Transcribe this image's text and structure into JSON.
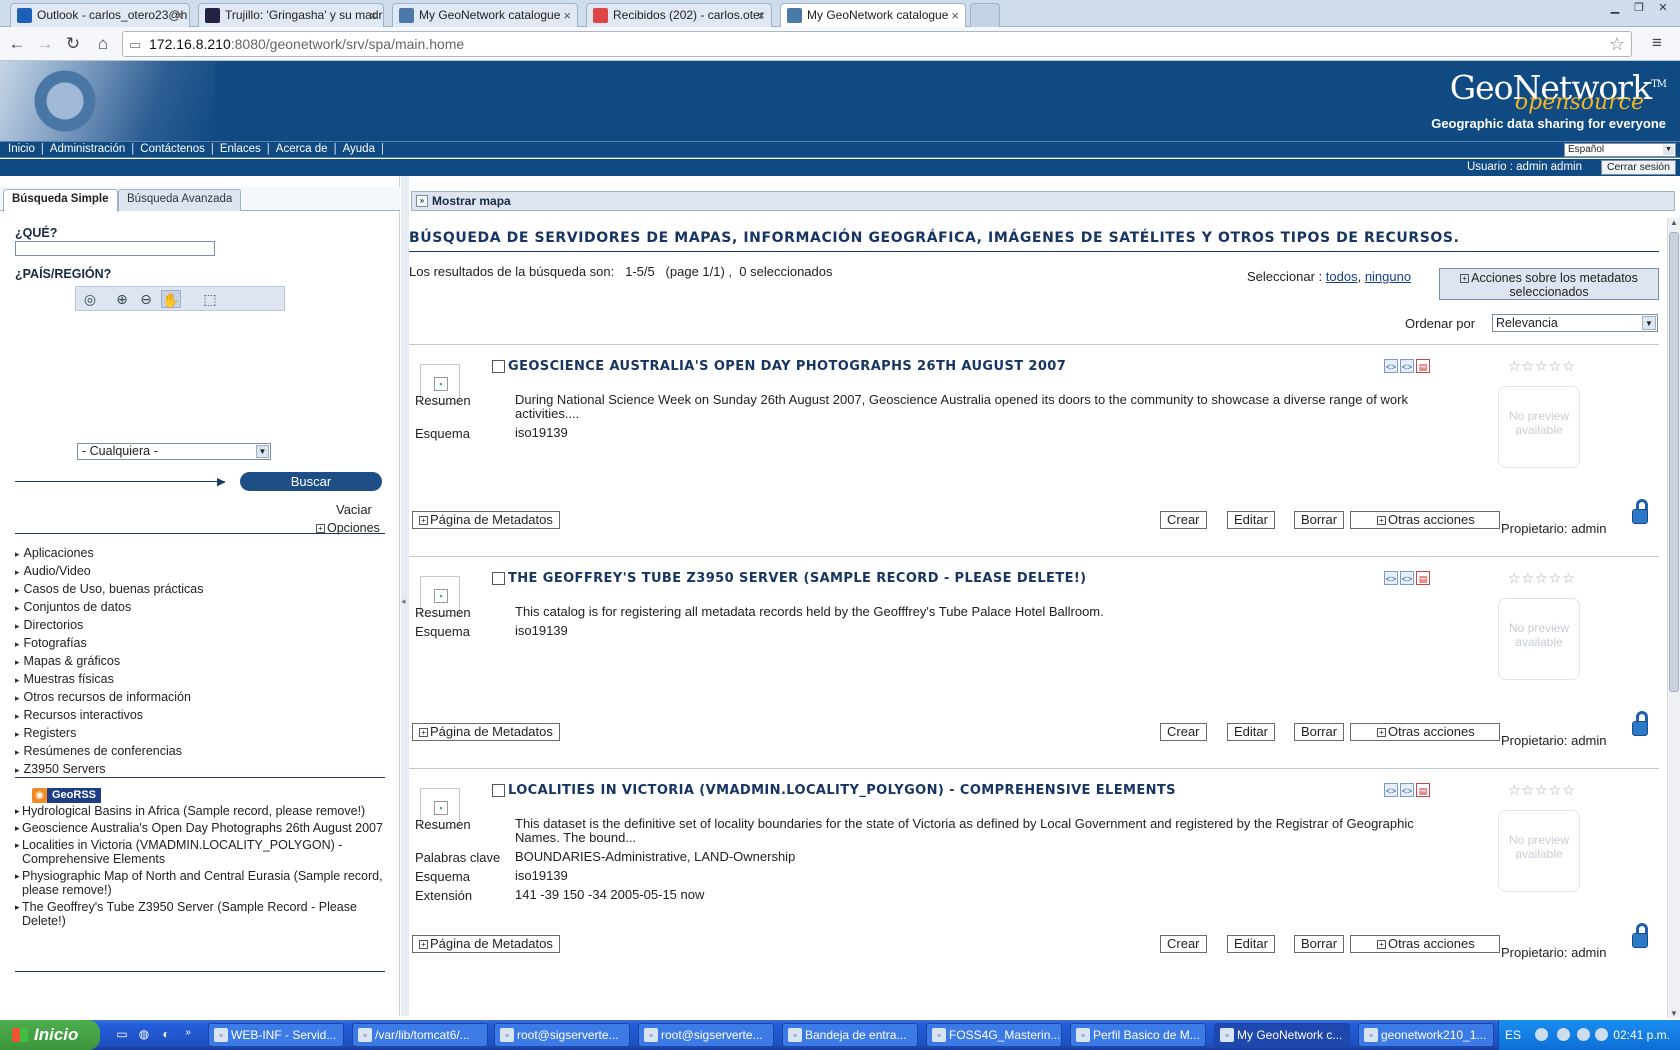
{
  "browser": {
    "tabs": [
      {
        "title": "Outlook - carlos_otero23@h",
        "favicon_color": "#1b5fb8"
      },
      {
        "title": "Trujillo: 'Gringasha' y su madr",
        "favicon_color": "#222244"
      },
      {
        "title": "My GeoNetwork catalogue",
        "favicon_color": "#4a78a8"
      },
      {
        "title": "Recibidos (202) - carlos.oter",
        "favicon_color": "#d44"
      },
      {
        "title": "My GeoNetwork catalogue",
        "favicon_color": "#4a78a8",
        "active": true
      }
    ],
    "url_host": "172.16.8.210",
    "url_rest": ":8080/geonetwork/srv/spa/main.home"
  },
  "header": {
    "logo_main": "GeoNetwork",
    "logo_tm": "TM",
    "logo_sub": "opensource",
    "tagline": "Geographic data sharing for everyone",
    "menu": [
      "Inicio",
      "Administración",
      "Contáctenos",
      "Enlaces",
      "Acerca de",
      "Ayuda"
    ],
    "language": "Español",
    "user_label": "Usuario : admin admin",
    "logout": "Cerrar sesión"
  },
  "search": {
    "tabs": [
      "Búsqueda Simple",
      "Búsqueda Avanzada"
    ],
    "what_label": "¿QUÉ?",
    "region_label": "¿PAÍS/REGIÓN?",
    "region_value": "- Cualquiera -",
    "search_button": "Buscar",
    "clear": "Vaciar",
    "options": "Opciones",
    "categories": [
      "Aplicaciones",
      "Audio/Video",
      "Casos de Uso, buenas prácticas",
      "Conjuntos de datos",
      "Directorios",
      "Fotografías",
      "Mapas & gráficos",
      "Muestras físicas",
      "Otros recursos de información",
      "Recursos interactivos",
      "Registers",
      "Resúmenes de conferencias",
      "Z3950 Servers"
    ],
    "georss_badge": "GeoRSS",
    "georss_items": [
      "Hydrological Basins in Africa (Sample record, please remove!)",
      "Geoscience Australia's Open Day Photographs 26th August 2007",
      "Localities in Victoria (VMADMIN.LOCALITY_POLYGON) - Comprehensive Elements",
      "Physiographic Map of North and Central Eurasia (Sample record, please remove!)",
      "The Geoffrey's Tube Z3950 Server (Sample Record - Please Delete!)"
    ]
  },
  "results": {
    "show_map": "Mostrar mapa",
    "title": "BÚSQUEDA DE SERVIDORES DE MAPAS, INFORMACIÓN GEOGRÁFICA, IMÁGENES DE SATÉLITES Y OTROS TIPOS DE RECURSOS.",
    "count_text": "Los resultados de la búsqueda son:   1-5/5   (page 1/1) ,  0 seleccionados",
    "select_label": "Seleccionar : ",
    "select_all": "todos",
    "select_none": "ninguno",
    "actions_button": "Acciones sobre los metadatos seleccionados",
    "order_label": "Ordenar por",
    "order_value": "Relevancia",
    "preview_text": "No preview available",
    "owner_text": "Propietario: admin",
    "btn_metadata": "Página de Metadatos",
    "btn_create": "Crear",
    "btn_edit": "Editar",
    "btn_delete": "Borrar",
    "btn_other": "Otras acciones",
    "records": [
      {
        "title": "GEOSCIENCE AUSTRALIA'S OPEN DAY PHOTOGRAPHS 26TH AUGUST 2007",
        "fields": [
          {
            "k": "Resumen",
            "v": "During National Science Week on Sunday 26th August 2007, Geoscience Australia opened its doors to the community to showcase a diverse range of work activities...."
          },
          {
            "k": "Esquema",
            "v": "iso19139"
          }
        ]
      },
      {
        "title": "THE GEOFFREY'S TUBE Z3950 SERVER (SAMPLE RECORD - PLEASE DELETE!)",
        "fields": [
          {
            "k": "Resumen",
            "v": "This catalog is for registering all metadata records held by the Geofffrey's Tube Palace Hotel Ballroom."
          },
          {
            "k": "Esquema",
            "v": "iso19139"
          }
        ]
      },
      {
        "title": "LOCALITIES IN VICTORIA (VMADMIN.LOCALITY_POLYGON) - COMPREHENSIVE ELEMENTS",
        "fields": [
          {
            "k": "Resumen",
            "v": "This dataset is the definitive set of locality boundaries for the state of Victoria as defined by Local Government and registered by the Registrar of Geographic Names. The bound..."
          },
          {
            "k": "Palabras clave",
            "v": "BOUNDARIES-Administrative, LAND-Ownership"
          },
          {
            "k": "Esquema",
            "v": "iso19139"
          },
          {
            "k": "Extensión",
            "v": "141 -39 150 -34   2005-05-15 now"
          }
        ]
      }
    ]
  },
  "taskbar": {
    "start": "Inicio",
    "tasks": [
      "WEB-INF - Servid...",
      "/var/lib/tomcat6/...",
      "root@sigserverte...",
      "root@sigserverte...",
      "Bandeja de entra...",
      "FOSS4G_Masterin...",
      "Perfil Basico de M...",
      "My GeoNetwork c...",
      "geonetwork210_1..."
    ],
    "active_task": 7,
    "lang": "ES",
    "clock": "02:41 p.m."
  }
}
